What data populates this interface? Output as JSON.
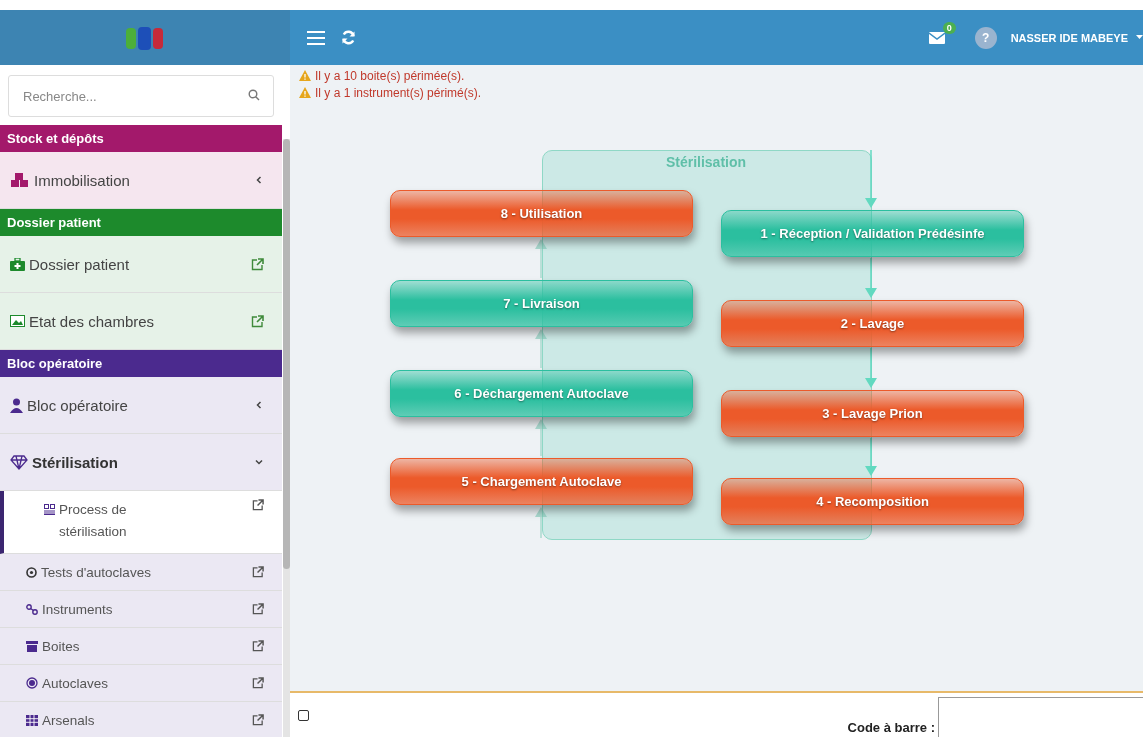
{
  "header": {
    "notifications": {
      "count": "0"
    },
    "help_glyph": "?",
    "user_name": "NASSER IDE MABEYE"
  },
  "sidebar": {
    "search": {
      "placeholder": "Recherche..."
    },
    "sections": [
      {
        "title": "Stock et dépôts",
        "color": "#a3196b",
        "items": [
          {
            "label": "Immobilisation",
            "kind": "menu",
            "expanded": false
          }
        ]
      },
      {
        "title": "Dossier patient",
        "color": "#1d8a2c",
        "items": [
          {
            "label": "Dossier patient",
            "kind": "link"
          },
          {
            "label": "Etat des chambres",
            "kind": "link"
          }
        ]
      },
      {
        "title": "Bloc opératoire",
        "color": "#4b2a8e",
        "items": [
          {
            "label": "Bloc opératoire",
            "kind": "menu",
            "expanded": false
          },
          {
            "label": "Stérilisation",
            "kind": "menu",
            "expanded": true,
            "children": [
              {
                "label": "Process de stérilisation",
                "selected": true
              },
              {
                "label": "Tests d'autoclaves",
                "selected": false
              },
              {
                "label": "Instruments",
                "selected": false
              },
              {
                "label": "Boites",
                "selected": false
              },
              {
                "label": "Autoclaves",
                "selected": false
              },
              {
                "label": "Arsenals",
                "selected": false
              }
            ]
          }
        ]
      }
    ]
  },
  "alerts": [
    "Il y a 10 boite(s) périmée(s).",
    "Il y a 1 instrument(s) périmé(s)."
  ],
  "process": {
    "title": "Stérilisation",
    "steps": [
      {
        "label": "8 - Utilisation",
        "color": "#ec5a2a"
      },
      {
        "label": "1 - Réception / Validation Prédésinfe",
        "color": "#2bbf9f"
      },
      {
        "label": "7 - Livraison",
        "color": "#2bbf9f"
      },
      {
        "label": "2 - Lavage",
        "color": "#ec5a2a"
      },
      {
        "label": "6 - Déchargement Autoclave",
        "color": "#2bbf9f"
      },
      {
        "label": "3 - Lavage Prion",
        "color": "#ec5a2a"
      },
      {
        "label": "5 - Chargement Autoclave",
        "color": "#ec5a2a"
      },
      {
        "label": "4 - Recomposition",
        "color": "#ec5a2a"
      }
    ]
  },
  "footer": {
    "checkbox_checked": false,
    "barcode_label": "Code à barre :"
  }
}
